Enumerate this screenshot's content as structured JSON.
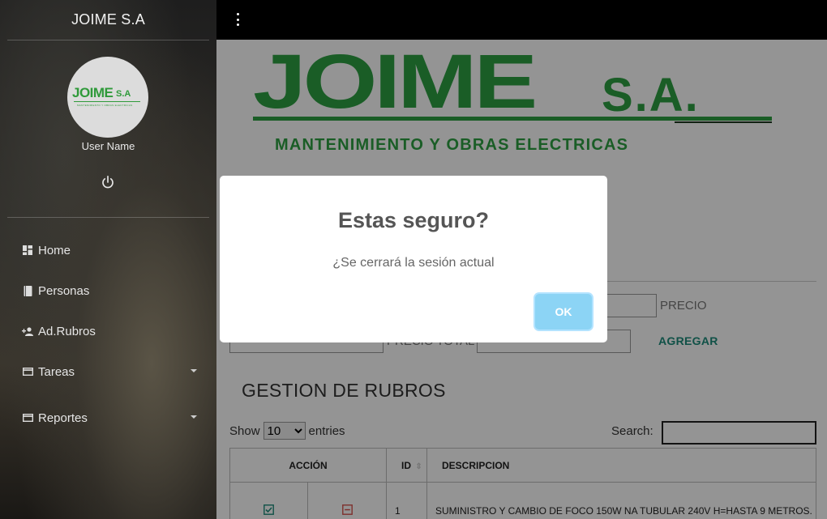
{
  "sidebar": {
    "brand": "JOIME S.A",
    "avatar_logo": {
      "main": "JOIME",
      "suffix": "S.A",
      "subtitle": "MANTENIMIENTO Y OBRAS ELECTRICAS"
    },
    "user_name": "User Name",
    "items": [
      {
        "label": "Home",
        "icon": "dashboard-icon",
        "has_caret": false
      },
      {
        "label": "Personas",
        "icon": "book-icon",
        "has_caret": false
      },
      {
        "label": "Ad.Rubros",
        "icon": "add-user-icon",
        "has_caret": false
      },
      {
        "label": "Tareas",
        "icon": "card-icon",
        "has_caret": true
      },
      {
        "label": "Reportes",
        "icon": "card-icon",
        "has_caret": true
      }
    ]
  },
  "banner": {
    "main": "JOIME",
    "suffix": "S.A.",
    "tagline": "MANTENIMIENTO Y OBRAS ELECTRICAS"
  },
  "form": {
    "precio_label": "PRECIO",
    "precio_total_label": "PRECIO TOTAL",
    "add_label": "AGREGAR"
  },
  "section_title": "GESTION DE RUBROS",
  "table_controls": {
    "show_label": "Show",
    "page_size": "10",
    "entries_label": "entries",
    "search_label": "Search:"
  },
  "table": {
    "headers": [
      "ACCIÓN",
      "ID",
      "DESCRIPCION"
    ],
    "rows": [
      {
        "id": "1",
        "descripcion": "SUMINISTRO Y CAMBIO DE FOCO 150W NA TUBULAR 240V H=HASTA 9 METROS."
      }
    ]
  },
  "modal": {
    "title": "Estas seguro?",
    "text": "¿Se cerrará la sesión actual",
    "ok_label": "OK"
  },
  "colors": {
    "brand_green": "#2ea043",
    "ok_button": "#8cd4f5",
    "link_teal": "#1d8c7a"
  }
}
